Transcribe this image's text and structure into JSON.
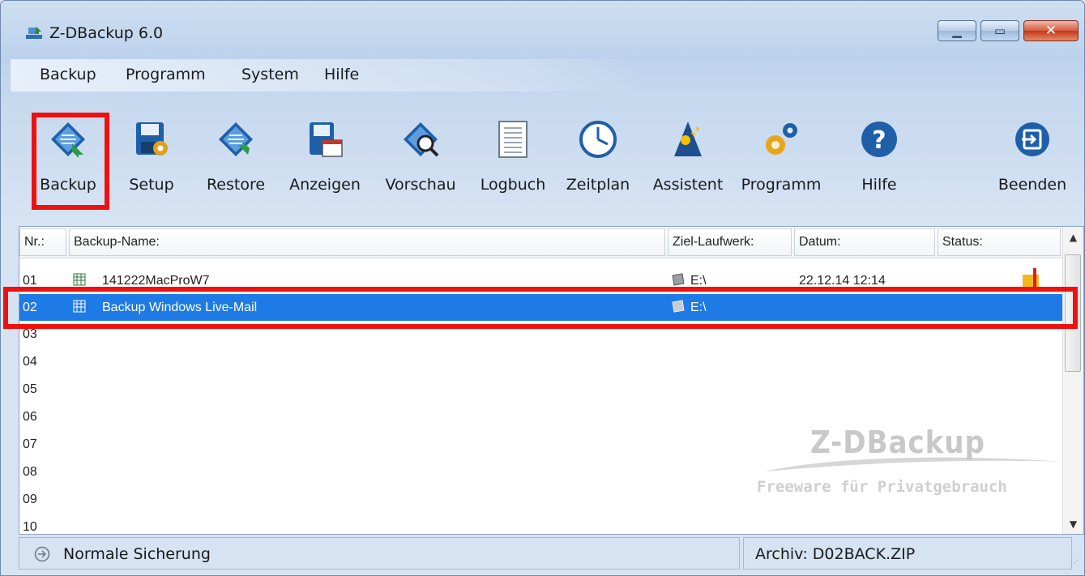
{
  "window": {
    "title": "Z-DBackup 6.0"
  },
  "menu": [
    "Backup",
    "Programm",
    "System",
    "Hilfe"
  ],
  "toolbar": [
    {
      "label": "Backup",
      "icon": "backup-icon"
    },
    {
      "label": "Setup",
      "icon": "setup-icon"
    },
    {
      "label": "Restore",
      "icon": "restore-icon"
    },
    {
      "label": "Anzeigen",
      "icon": "view-icon"
    },
    {
      "label": "Vorschau",
      "icon": "preview-icon"
    },
    {
      "label": "Logbuch",
      "icon": "logbook-icon"
    },
    {
      "label": "Zeitplan",
      "icon": "clock-icon"
    },
    {
      "label": "Assistent",
      "icon": "wizard-icon"
    },
    {
      "label": "Programm",
      "icon": "gears-icon"
    },
    {
      "label": "Hilfe",
      "icon": "help-icon"
    },
    {
      "label": "Beenden",
      "icon": "exit-icon"
    }
  ],
  "list": {
    "columns": [
      "Nr.:",
      "Backup-Name:",
      "Ziel-Laufwerk:",
      "Datum:",
      "Status:"
    ],
    "rows": [
      {
        "nr": "01",
        "name": "141222MacProW7",
        "drive": "E:\\",
        "date": "22.12.14 12:14",
        "selected": false
      },
      {
        "nr": "02",
        "name": "Backup Windows Live-Mail",
        "drive": "E:\\",
        "date": "",
        "selected": true
      },
      {
        "nr": "03"
      },
      {
        "nr": "04"
      },
      {
        "nr": "05"
      },
      {
        "nr": "06"
      },
      {
        "nr": "07"
      },
      {
        "nr": "08"
      },
      {
        "nr": "09"
      },
      {
        "nr": "10"
      }
    ]
  },
  "watermark": {
    "title": "Z-DBackup",
    "subtitle": "Freeware für Privatgebrauch"
  },
  "status": {
    "mode": "Normale Sicherung",
    "archive": "Archiv: D02BACK.ZIP"
  },
  "colors": {
    "selection": "#1e7be6",
    "highlight": "#ef1010"
  }
}
